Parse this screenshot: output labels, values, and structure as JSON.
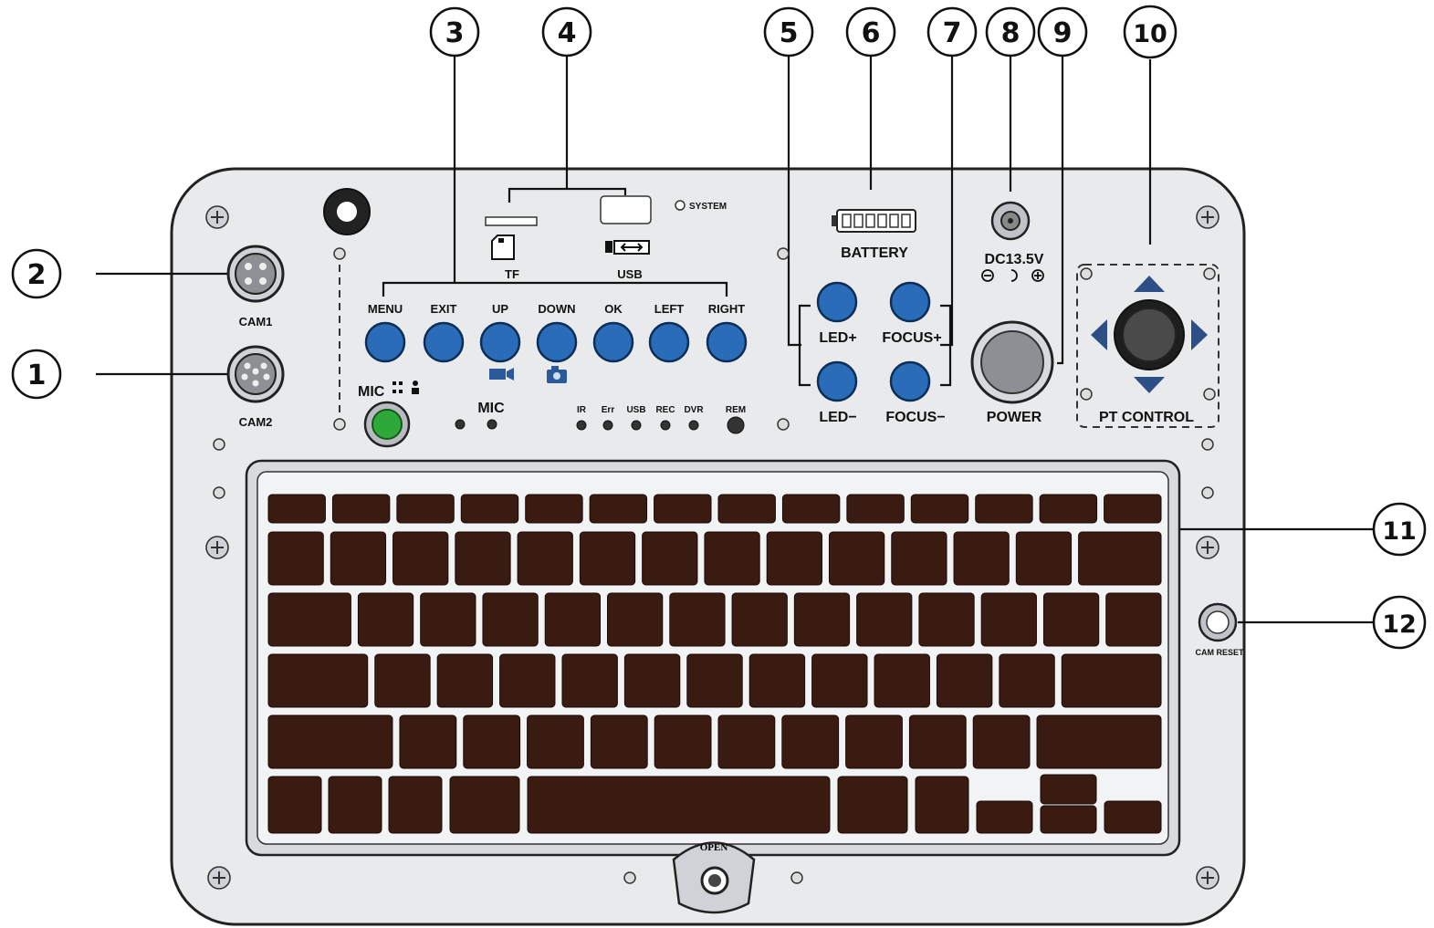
{
  "callouts": [
    "1",
    "2",
    "3",
    "4",
    "5",
    "6",
    "7",
    "8",
    "9",
    "10",
    "11",
    "12"
  ],
  "connectors": {
    "cam1": "CAM1",
    "cam2": "CAM2"
  },
  "storage": {
    "tf": "TF",
    "usb": "USB",
    "system": "SYSTEM"
  },
  "function_buttons": [
    "MENU",
    "EXIT",
    "UP",
    "DOWN",
    "OK",
    "LEFT",
    "RIGHT"
  ],
  "mic": {
    "button_label": "MIC",
    "mic_label": "MIC"
  },
  "indicators": [
    "IR",
    "Err",
    "USB",
    "REC",
    "DVR",
    "REM"
  ],
  "led_buttons": {
    "plus": "LED+",
    "minus": "LED−"
  },
  "focus_buttons": {
    "plus": "FOCUS+",
    "minus": "FOCUS−"
  },
  "battery": {
    "label": "BATTERY"
  },
  "power_input": {
    "label": "DC13.5V"
  },
  "power": {
    "label": "POWER"
  },
  "pt_control": {
    "label": "PT  CONTROL"
  },
  "cam_reset": {
    "label": "CAM RESET"
  },
  "latch": {
    "label": "OPEN"
  },
  "colors": {
    "panel": "#e9eaec",
    "button_blue": "#2a6cb8",
    "key_brown": "#3a1b12",
    "mic_green": "#2fa83a",
    "joystick": "#3a3a3a"
  }
}
